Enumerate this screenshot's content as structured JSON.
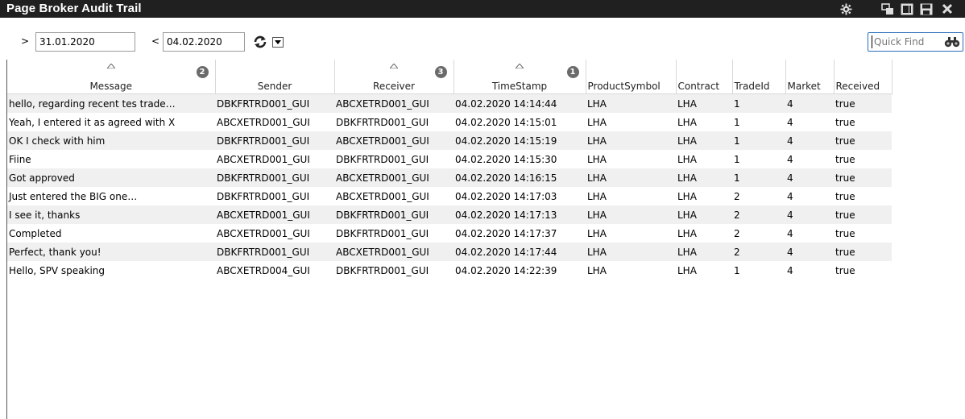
{
  "window": {
    "title": "Page Broker Audit Trail",
    "controls": [
      "gear-icon",
      "restore-icon",
      "detach-icon",
      "save-icon",
      "close-icon"
    ]
  },
  "toolbar": {
    "from_prefix": ">",
    "from_date": "31.01.2020",
    "to_prefix": "<",
    "to_date": "04.02.2020",
    "refresh_icon": "refresh-icon",
    "dropdown_icon": "dropdown-arrow-icon",
    "quick_find_placeholder": "Quick Find",
    "quick_find_icon": "binoculars-icon"
  },
  "grid": {
    "columns": [
      {
        "key": "message",
        "label": "Message",
        "sorted": true,
        "sort_order": "2"
      },
      {
        "key": "sender",
        "label": "Sender",
        "sorted": false,
        "sort_order": ""
      },
      {
        "key": "receiver",
        "label": "Receiver",
        "sorted": true,
        "sort_order": "3"
      },
      {
        "key": "timestamp",
        "label": "TimeStamp",
        "sorted": true,
        "sort_order": "1"
      },
      {
        "key": "product",
        "label": "ProductSymbol",
        "sorted": false,
        "sort_order": ""
      },
      {
        "key": "contract",
        "label": "Contract",
        "sorted": false,
        "sort_order": ""
      },
      {
        "key": "tradeid",
        "label": "TradeId",
        "sorted": false,
        "sort_order": ""
      },
      {
        "key": "market",
        "label": "Market",
        "sorted": false,
        "sort_order": ""
      },
      {
        "key": "received",
        "label": "Received",
        "sorted": false,
        "sort_order": ""
      }
    ],
    "rows": [
      {
        "message": "hello, regarding recent tes trade…",
        "sender": "DBKFRTRD001_GUI",
        "receiver": "ABCXETRD001_GUI",
        "timestamp": "04.02.2020 14:14:44",
        "product": "LHA",
        "contract": "LHA",
        "tradeid": "1",
        "market": "4",
        "received": "true"
      },
      {
        "message": "Yeah, I entered it as agreed with X",
        "sender": "ABCXETRD001_GUI",
        "receiver": "DBKFRTRD001_GUI",
        "timestamp": "04.02.2020 14:15:01",
        "product": "LHA",
        "contract": "LHA",
        "tradeid": "1",
        "market": "4",
        "received": "true"
      },
      {
        "message": "OK I check with him",
        "sender": "DBKFRTRD001_GUI",
        "receiver": "ABCXETRD001_GUI",
        "timestamp": "04.02.2020 14:15:19",
        "product": "LHA",
        "contract": "LHA",
        "tradeid": "1",
        "market": "4",
        "received": "true"
      },
      {
        "message": "Fiine",
        "sender": "ABCXETRD001_GUI",
        "receiver": "DBKFRTRD001_GUI",
        "timestamp": "04.02.2020 14:15:30",
        "product": "LHA",
        "contract": "LHA",
        "tradeid": "1",
        "market": "4",
        "received": "true"
      },
      {
        "message": "Got approved",
        "sender": "DBKFRTRD001_GUI",
        "receiver": "ABCXETRD001_GUI",
        "timestamp": "04.02.2020 14:16:15",
        "product": "LHA",
        "contract": "LHA",
        "tradeid": "1",
        "market": "4",
        "received": "true"
      },
      {
        "message": "Just entered the BIG one…",
        "sender": "DBKFRTRD001_GUI",
        "receiver": "ABCXETRD001_GUI",
        "timestamp": "04.02.2020 14:17:03",
        "product": "LHA",
        "contract": "LHA",
        "tradeid": "2",
        "market": "4",
        "received": "true"
      },
      {
        "message": "I see it, thanks",
        "sender": "ABCXETRD001_GUI",
        "receiver": "DBKFRTRD001_GUI",
        "timestamp": "04.02.2020 14:17:13",
        "product": "LHA",
        "contract": "LHA",
        "tradeid": "2",
        "market": "4",
        "received": "true"
      },
      {
        "message": "Completed",
        "sender": "ABCXETRD001_GUI",
        "receiver": "DBKFRTRD001_GUI",
        "timestamp": "04.02.2020 14:17:37",
        "product": "LHA",
        "contract": "LHA",
        "tradeid": "2",
        "market": "4",
        "received": "true"
      },
      {
        "message": "Perfect, thank you!",
        "sender": "DBKFRTRD001_GUI",
        "receiver": "ABCXETRD001_GUI",
        "timestamp": "04.02.2020 14:17:44",
        "product": "LHA",
        "contract": "LHA",
        "tradeid": "2",
        "market": "4",
        "received": "true"
      },
      {
        "message": "Hello, SPV speaking",
        "sender": "ABCXETRD004_GUI",
        "receiver": "DBKFRTRD001_GUI",
        "timestamp": "04.02.2020 14:22:39",
        "product": "LHA",
        "contract": "LHA",
        "tradeid": "1",
        "market": "4",
        "received": "true"
      }
    ]
  },
  "colors": {
    "titlebar_bg": "#202020",
    "row_alt_bg": "#f0f0f0",
    "quickfind_border": "#2a6eb9",
    "badge_bg": "#6a6a6a"
  }
}
